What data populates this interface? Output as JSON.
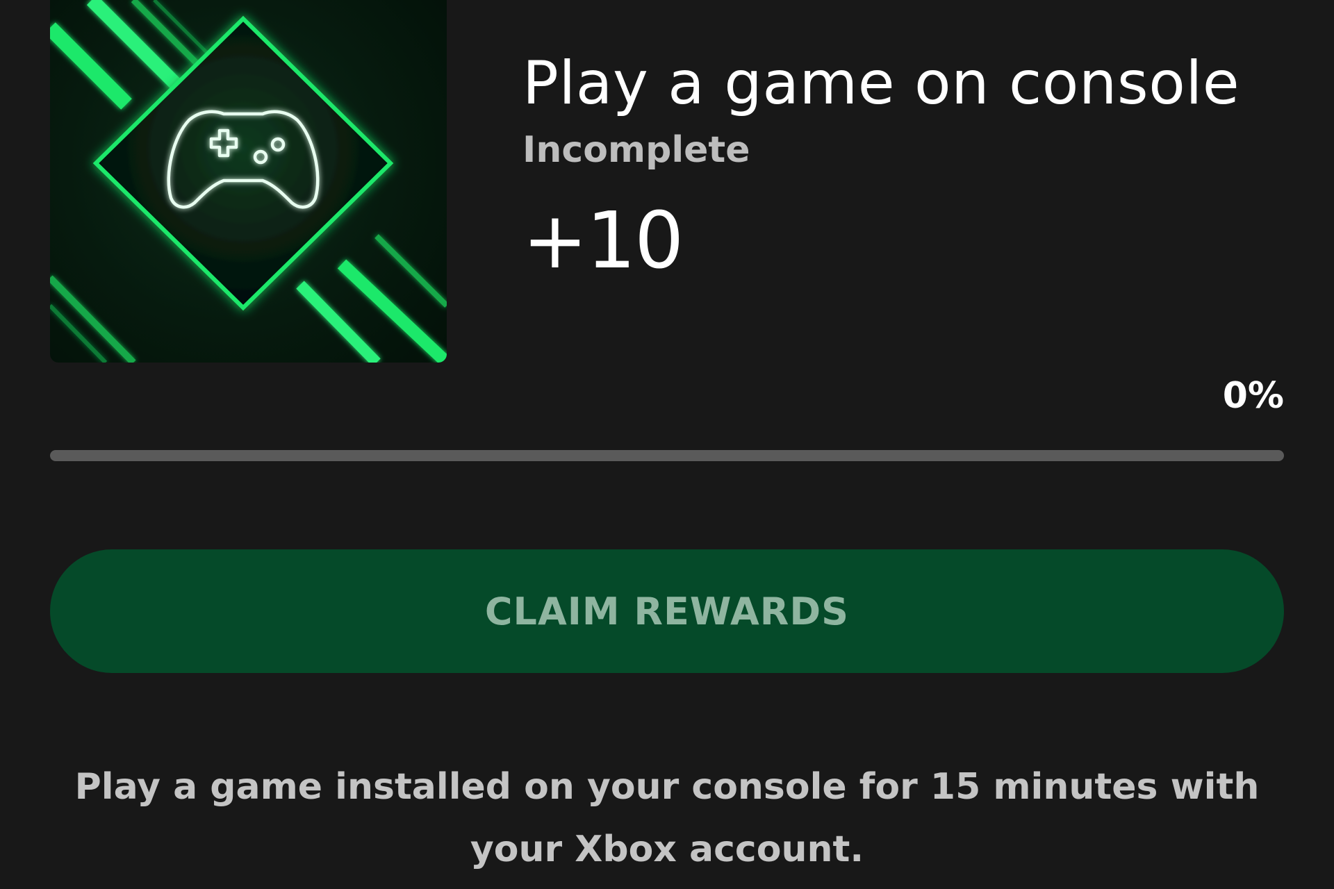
{
  "quest": {
    "title": "Play a game on console",
    "status": "Incomplete",
    "points": "+10",
    "progress_label": "0%",
    "progress_fraction": 0.0,
    "claim_label": "CLAIM REWARDS",
    "description": "Play a game installed on your console for 15 minutes with your Xbox account.",
    "image_icon": "controller-icon"
  },
  "colors": {
    "background": "#181818",
    "accent_green": "#1ee86a",
    "button_bg": "#054a29",
    "button_text": "#8fb5a0",
    "progress_track": "#5a5a5a"
  }
}
